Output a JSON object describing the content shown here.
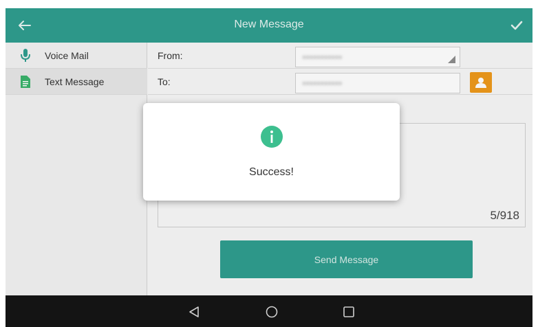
{
  "titlebar": {
    "title": "New Message"
  },
  "sidebar": {
    "items": [
      {
        "label": "Voice Mail",
        "icon": "microphone-icon",
        "active": false
      },
      {
        "label": "Text Message",
        "icon": "document-icon",
        "active": true
      }
    ]
  },
  "form": {
    "from_label": "From:",
    "to_label": "To:",
    "counter": "5/918",
    "send_label": "Send Message"
  },
  "dialog": {
    "message": "Success!",
    "icon": "info-icon"
  },
  "navbar": {
    "buttons": [
      "back-triangle-icon",
      "home-circle-icon",
      "recents-square-icon"
    ]
  },
  "colors": {
    "accent": "#2f9e8f",
    "contact_button": "#ee9a1c",
    "info_icon": "#3dbf8f",
    "navbar": "#141414"
  }
}
